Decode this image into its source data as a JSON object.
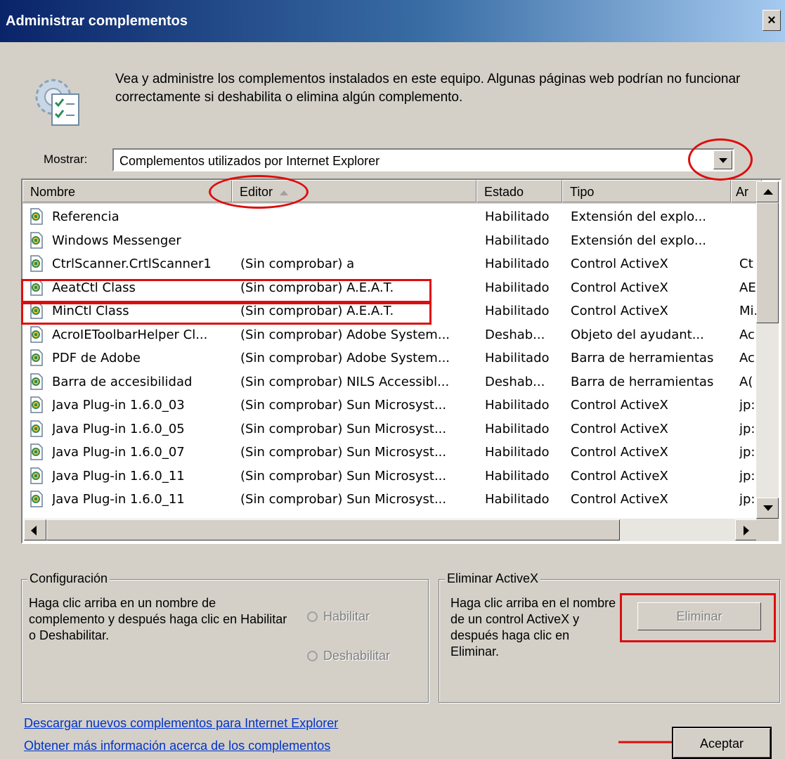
{
  "window": {
    "title": "Administrar complementos",
    "close_glyph": "×"
  },
  "intro": {
    "icon": "manage-addons-icon",
    "text": "Vea y administre los complementos instalados en este equipo. Algunas páginas web podrían no funcionar correctamente si deshabilita o elimina algún complemento."
  },
  "show": {
    "label": "Mostrar:",
    "value": "Complementos utilizados por Internet Explorer"
  },
  "table": {
    "columns": [
      "Nombre",
      "Editor",
      "Estado",
      "Tipo",
      "Ar"
    ],
    "rows": [
      {
        "name": "Referencia",
        "publisher": "",
        "status": "Habilitado",
        "type": "Extensión del explo...",
        "file": ""
      },
      {
        "name": "Windows Messenger",
        "publisher": "",
        "status": "Habilitado",
        "type": "Extensión del explo...",
        "file": ""
      },
      {
        "name": "CtrlScanner.CrtlScanner1",
        "publisher": "(Sin comprobar) a",
        "status": "Habilitado",
        "type": "Control ActiveX",
        "file": "Ct"
      },
      {
        "name": "AeatCtl Class",
        "publisher": "(Sin comprobar) A.E.A.T.",
        "status": "Habilitado",
        "type": "Control ActiveX",
        "file": "AE"
      },
      {
        "name": "MinCtl Class",
        "publisher": "(Sin comprobar) A.E.A.T.",
        "status": "Habilitado",
        "type": "Control ActiveX",
        "file": "Mi."
      },
      {
        "name": "AcroIEToolbarHelper Cl...",
        "publisher": "(Sin comprobar) Adobe System...",
        "status": "Deshab...",
        "type": "Objeto del ayudant...",
        "file": "Ac"
      },
      {
        "name": "PDF de Adobe",
        "publisher": "(Sin comprobar) Adobe System...",
        "status": "Habilitado",
        "type": "Barra de herramientas",
        "file": "Ac"
      },
      {
        "name": "Barra de accesibilidad",
        "publisher": "(Sin comprobar) NILS Accessibl...",
        "status": "Deshab...",
        "type": "Barra de herramientas",
        "file": "A("
      },
      {
        "name": "Java Plug-in 1.6.0_03",
        "publisher": "(Sin comprobar) Sun Microsyst...",
        "status": "Habilitado",
        "type": "Control ActiveX",
        "file": "jp:"
      },
      {
        "name": "Java Plug-in 1.6.0_05",
        "publisher": "(Sin comprobar) Sun Microsyst...",
        "status": "Habilitado",
        "type": "Control ActiveX",
        "file": "jp:"
      },
      {
        "name": "Java Plug-in 1.6.0_07",
        "publisher": "(Sin comprobar) Sun Microsyst...",
        "status": "Habilitado",
        "type": "Control ActiveX",
        "file": "jp:"
      },
      {
        "name": "Java Plug-in 1.6.0_11",
        "publisher": "(Sin comprobar) Sun Microsyst...",
        "status": "Habilitado",
        "type": "Control ActiveX",
        "file": "jp:"
      },
      {
        "name": "Java Plug-in 1.6.0_11",
        "publisher": "(Sin comprobar) Sun Microsyst...",
        "status": "Habilitado",
        "type": "Control ActiveX",
        "file": "jp:"
      }
    ]
  },
  "settings": {
    "title": "Configuración",
    "text": "Haga clic arriba en un nombre de complemento y después haga clic en Habilitar o Deshabilitar.",
    "enable_label": "Habilitar",
    "disable_label": "Deshabilitar"
  },
  "activex": {
    "title": "Eliminar ActiveX",
    "text": "Haga clic arriba en el nombre de un control ActiveX y después haga clic en Eliminar.",
    "delete_label": "Eliminar"
  },
  "links": {
    "download": "Descargar nuevos complementos para Internet Explorer",
    "more_info": "Obtener más información acerca de los complementos"
  },
  "ok_label": "Aceptar",
  "colors": {
    "annotation": "#dd0d0d",
    "link": "#0033cc",
    "dialog_bg": "#d4d0c8"
  }
}
